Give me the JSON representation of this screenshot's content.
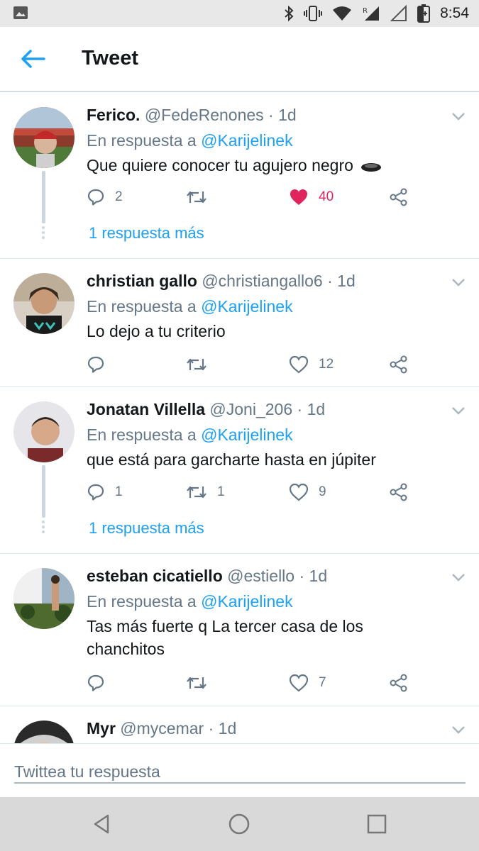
{
  "status_bar": {
    "time": "8:54",
    "icons": [
      "image-icon",
      "bluetooth-icon",
      "vibrate-icon",
      "wifi-icon",
      "signal-roaming-icon",
      "signal-empty-icon",
      "battery-charging-icon"
    ]
  },
  "header": {
    "title": "Tweet",
    "back_icon": "arrow-left-icon"
  },
  "tweets": [
    {
      "name": "Ferico.",
      "handle": "@FedeRenones",
      "separator": "·",
      "time": "1d",
      "reply_prefix": "En respuesta a",
      "reply_to": "@Karijelinek",
      "text": "Que quiere conocer tu agujero negro",
      "emoji": "black-hole-emoji",
      "replies": "2",
      "retweets": "",
      "likes": "40",
      "liked": true,
      "more_replies": "1 respuesta más"
    },
    {
      "name": "christian gallo",
      "handle": "@christiangallo6",
      "separator": "·",
      "time": "1d",
      "reply_prefix": "En respuesta a",
      "reply_to": "@Karijelinek",
      "text": "Lo dejo a tu criterio",
      "replies": "",
      "retweets": "",
      "likes": "12",
      "liked": false
    },
    {
      "name": "Jonatan Villella",
      "handle": "@Joni_206",
      "separator": "·",
      "time": "1d",
      "reply_prefix": "En respuesta a",
      "reply_to": "@Karijelinek",
      "text": "que está para garcharte hasta en júpiter",
      "replies": "1",
      "retweets": "1",
      "likes": "9",
      "liked": false,
      "more_replies": "1 respuesta más"
    },
    {
      "name": "esteban cicatiello",
      "handle": "@estiello",
      "separator": "·",
      "time": "1d",
      "reply_prefix": "En respuesta a",
      "reply_to": "@Karijelinek",
      "text_line1": "Tas más fuerte q La tercer casa de los",
      "text_line2": "chanchitos",
      "replies": "",
      "retweets": "",
      "likes": "7",
      "liked": false
    },
    {
      "name": "Myr",
      "handle": "@mycemar",
      "separator": "·",
      "time": "1d"
    }
  ],
  "composer": {
    "placeholder": "Twittea tu respuesta"
  },
  "nav_bar": {
    "icons": [
      "back-triangle-icon",
      "home-circle-icon",
      "recents-square-icon"
    ]
  },
  "colors": {
    "accent": "#1da1f2",
    "like": "#e0245e",
    "muted": "#657786",
    "text": "#14171a"
  }
}
